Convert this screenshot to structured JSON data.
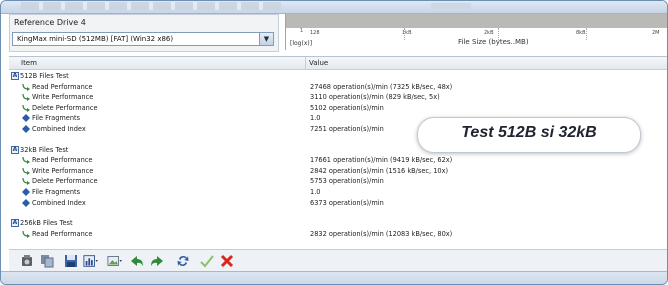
{
  "reference": {
    "label": "Reference Drive 4",
    "selected": "KingMax mini-SD (512MB) [FAT] (Win32 x86)"
  },
  "scale": {
    "tick_labels": [
      "1",
      "128",
      "1kB",
      "2kB",
      "8kB",
      "2M",
      "8M"
    ],
    "y_label": "[log(x)]",
    "x_label": "File Size (bytes..MB)"
  },
  "table": {
    "col_item": "Item",
    "col_value": "Value",
    "groups": [
      {
        "title": "512B Files Test",
        "rows": [
          {
            "name": "Read Performance",
            "value": "27468 operation(s)/min (7325 kB/sec, 48x)",
            "icon": "arrow-icon"
          },
          {
            "name": "Write Performance",
            "value": "3110 operation(s)/min (829 kB/sec, 5x)",
            "icon": "arrow-icon"
          },
          {
            "name": "Delete Performance",
            "value": "5102 operation(s)/min",
            "icon": "arrow-icon"
          },
          {
            "name": "File Fragments",
            "value": "1.0",
            "icon": "diamond-icon"
          },
          {
            "name": "Combined Index",
            "value": "7251 operation(s)/min",
            "icon": "diamond-icon"
          }
        ]
      },
      {
        "title": "32kB Files Test",
        "rows": [
          {
            "name": "Read Performance",
            "value": "17661 operation(s)/min (9419 kB/sec, 62x)",
            "icon": "arrow-icon"
          },
          {
            "name": "Write Performance",
            "value": "2842 operation(s)/min (1516 kB/sec, 10x)",
            "icon": "arrow-icon"
          },
          {
            "name": "Delete Performance",
            "value": "5753 operation(s)/min",
            "icon": "arrow-icon"
          },
          {
            "name": "File Fragments",
            "value": "1.0",
            "icon": "diamond-icon"
          },
          {
            "name": "Combined Index",
            "value": "6373 operation(s)/min",
            "icon": "diamond-icon"
          }
        ]
      },
      {
        "title": "256kB Files Test",
        "rows": [
          {
            "name": "Read Performance",
            "value": "2832 operation(s)/min (12083 kB/sec, 80x)",
            "icon": "arrow-icon"
          }
        ]
      }
    ]
  },
  "overlay": {
    "text": "Test 512B si 32kB"
  },
  "toolbar": {
    "icons": [
      "camera-icon",
      "copy-icon",
      "save-icon",
      "chart-icon",
      "image-icon",
      "back-icon",
      "forward-icon",
      "refresh-icon",
      "check-icon",
      "cancel-icon"
    ]
  },
  "colors": {
    "accent": "#3f6aa6",
    "cancel": "#d9261c",
    "check": "#8fbf6a",
    "arrow": "#2f8a3b"
  }
}
